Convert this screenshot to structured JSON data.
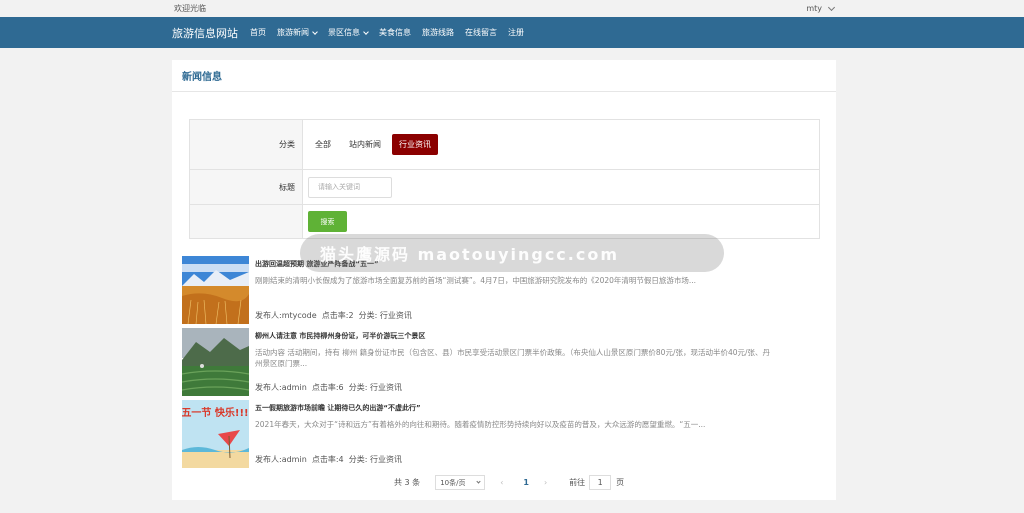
{
  "topbar": {
    "welcome": "欢迎光临",
    "user": "mty"
  },
  "nav": {
    "brand": "旅游信息网站",
    "items": [
      "首页",
      "旅游新闻",
      "景区信息",
      "美食信息",
      "旅游线路",
      "在线留言",
      "注册"
    ]
  },
  "panel": {
    "title": "新闻信息"
  },
  "filter": {
    "category_label": "分类",
    "categories": [
      "全部",
      "站内新闻",
      "行业资讯"
    ],
    "active_category": "行业资讯",
    "title_label": "标题",
    "keyword_placeholder": "请输入关键词",
    "search_label": "搜索"
  },
  "news": [
    {
      "title": "出游回温超预期 旅游业严阵备战“五一”",
      "summary": "刚刚结束的清明小长假成为了旅游市场全面复苏前的首场“测试赛”。4月7日，中国旅游研究院发布的《2020年清明节假日旅游市场...",
      "publisher": "发布人:mtycode",
      "clicks": "点击率:2",
      "category": "分类: 行业资讯"
    },
    {
      "title": "柳州人请注意 市民持柳州身份证，可半价游玩三个景区",
      "summary": "活动内容 活动期间，持有 柳州 籍身份证市民（包含区、县）市民享受活动景区门票半价政策。（布央仙人山景区原门票价80元/张，现活动半价40元/张、丹州景区原门票...",
      "publisher": "发布人:admin",
      "clicks": "点击率:6",
      "category": "分类: 行业资讯"
    },
    {
      "title": "五一假期旅游市场前瞻 让期待已久的出游“不虚此行”",
      "summary": "2021年春天，大众对于“诗和远方”有着格外的向往和期待。随着疫情防控形势持续向好以及疫苗的普及，大众远游的愿望重燃。“五一...",
      "publisher": "发布人:admin",
      "clicks": "点击率:4",
      "category": "分类: 行业资讯",
      "thumb_text": "五一节 快乐!!!"
    }
  ],
  "pagination": {
    "total": "共 3 条",
    "page_size": "10条/页",
    "prev": "‹",
    "current": "1",
    "next": "›",
    "goto_label": "前往",
    "goto_value": "1",
    "unit": "页"
  },
  "watermark": "猫头鹰源码 maotouyingcc.com"
}
